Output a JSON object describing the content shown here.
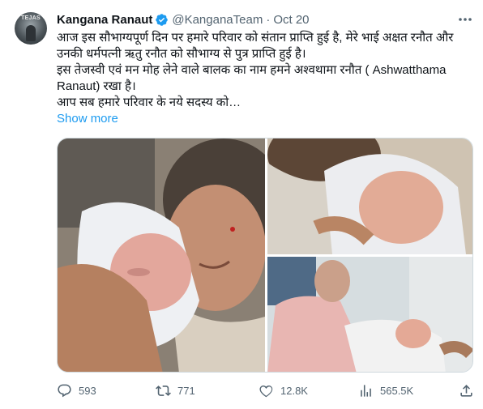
{
  "tweet": {
    "author_name": "Kangana Ranaut",
    "handle": "@KanganaTeam",
    "separator": "·",
    "date": "Oct 20",
    "avatar_text": "TEJAS",
    "body_lines": [
      "आज इस सौभाग्यपूर्ण दिन पर हमारे परिवार को संतान प्राप्ति हुई है, मेरे भाई अक्षत रनौत और उनकी धर्मपत्नी ऋतु रनौत को सौभाग्य से पुत्र प्राप्ति हुई है।",
      "इस तेजस्वी एवं मन मोह लेने वाले बालक का नाम हमने अश्वथामा रनौत ( Ashwatthama Ranaut) रखा है।",
      "आप सब हमारे परिवार के नये सदस्य को…"
    ],
    "show_more": "Show more"
  },
  "actions": {
    "reply_count": "593",
    "retweet_count": "771",
    "like_count": "12.8K",
    "views_count": "565.5K"
  },
  "icons": {
    "verified": "verified-badge-icon",
    "more": "more-options-icon",
    "reply": "reply-icon",
    "retweet": "retweet-icon",
    "like": "heart-icon",
    "views": "views-chart-icon",
    "share": "share-icon"
  },
  "colors": {
    "accent": "#1d9bf0",
    "text": "#0f1419",
    "secondary": "#536471",
    "border": "#cfd9de"
  }
}
